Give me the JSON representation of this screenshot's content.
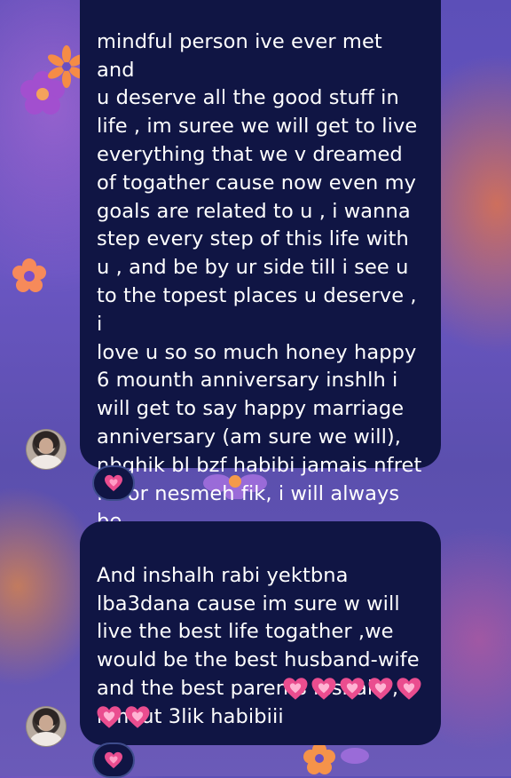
{
  "messages": [
    {
      "text": "mindful person ive ever met and\nu deserve all the good stuff in\nlife , im suree we will get to live\neverything that we v dreamed\nof togather cause now even my\ngoals are related to u , i wanna\nstep every step of this life with\nu , and be by ur side till i see u\nto the topest places u deserve , i\nlove u so so much honey happy\n6 mounth anniversary inshlh i\nwill get to say happy marriage\nanniversary (am sure we will),\nnbghik bl bzf habibi jamais nfret\nfik or nesmeh fik, i will always be\nhere for u",
      "reaction": "sparkling-heart"
    },
    {
      "text": "And inshalh rabi yektbna\nlba3dana cause im sure w will\nlive the best life togather ,we\nwould be the best husband-wife\nand the best parents inshalh ,\nnmout 3lik habibiii",
      "trailing_emoji": "sparkling-heart x7",
      "reaction": "sparkling-heart"
    }
  ],
  "colors": {
    "bubble": "#101544",
    "text": "#ffffff",
    "heart": "#ea4d8f",
    "background": "#5c4fb8"
  }
}
